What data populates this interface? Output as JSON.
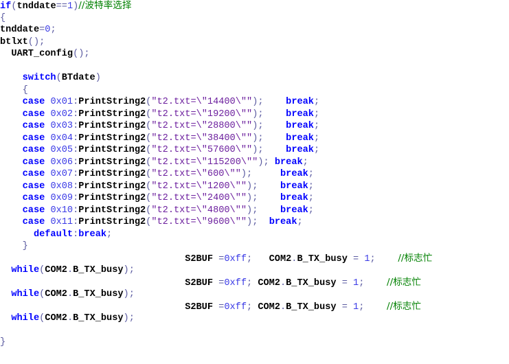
{
  "code_lines": [
    {
      "segments": [
        {
          "t": "if",
          "c": "kw"
        },
        {
          "t": "(",
          "c": "op"
        },
        {
          "t": "tnddate",
          "c": "id"
        },
        {
          "t": "==",
          "c": "op"
        },
        {
          "t": "1",
          "c": "num"
        },
        {
          "t": ")",
          "c": "op"
        },
        {
          "t": "//波特率选择",
          "c": "cmt"
        }
      ]
    },
    {
      "segments": [
        {
          "t": "{",
          "c": "op"
        }
      ]
    },
    {
      "segments": [
        {
          "t": "tnddate",
          "c": "id"
        },
        {
          "t": "=",
          "c": "op"
        },
        {
          "t": "0",
          "c": "num"
        },
        {
          "t": ";",
          "c": "op"
        }
      ]
    },
    {
      "segments": [
        {
          "t": "btlxt",
          "c": "id"
        },
        {
          "t": "();",
          "c": "op"
        }
      ]
    },
    {
      "segments": [
        {
          "t": "  "
        },
        {
          "t": "UART_config",
          "c": "id"
        },
        {
          "t": "();",
          "c": "op"
        }
      ]
    },
    {
      "segments": []
    },
    {
      "segments": [
        {
          "t": "    "
        },
        {
          "t": "switch",
          "c": "kw"
        },
        {
          "t": "(",
          "c": "op"
        },
        {
          "t": "BTdate",
          "c": "id"
        },
        {
          "t": ")",
          "c": "op"
        }
      ]
    },
    {
      "segments": [
        {
          "t": "    "
        },
        {
          "t": "{",
          "c": "op"
        }
      ]
    },
    {
      "segments": [
        {
          "t": "    "
        },
        {
          "t": "case",
          "c": "kw"
        },
        {
          "t": " "
        },
        {
          "t": "0x01",
          "c": "num"
        },
        {
          "t": ":",
          "c": "op"
        },
        {
          "t": "PrintString2",
          "c": "id"
        },
        {
          "t": "(",
          "c": "op"
        },
        {
          "t": "\"t2.txt=\\\"14400\\\"\"",
          "c": "str"
        },
        {
          "t": ");",
          "c": "op"
        },
        {
          "t": "    "
        },
        {
          "t": "break",
          "c": "kw"
        },
        {
          "t": ";",
          "c": "op"
        }
      ]
    },
    {
      "segments": [
        {
          "t": "    "
        },
        {
          "t": "case",
          "c": "kw"
        },
        {
          "t": " "
        },
        {
          "t": "0x02",
          "c": "num"
        },
        {
          "t": ":",
          "c": "op"
        },
        {
          "t": "PrintString2",
          "c": "id"
        },
        {
          "t": "(",
          "c": "op"
        },
        {
          "t": "\"t2.txt=\\\"19200\\\"\"",
          "c": "str"
        },
        {
          "t": ");",
          "c": "op"
        },
        {
          "t": "    "
        },
        {
          "t": "break",
          "c": "kw"
        },
        {
          "t": ";",
          "c": "op"
        }
      ]
    },
    {
      "segments": [
        {
          "t": "    "
        },
        {
          "t": "case",
          "c": "kw"
        },
        {
          "t": " "
        },
        {
          "t": "0x03",
          "c": "num"
        },
        {
          "t": ":",
          "c": "op"
        },
        {
          "t": "PrintString2",
          "c": "id"
        },
        {
          "t": "(",
          "c": "op"
        },
        {
          "t": "\"t2.txt=\\\"28800\\\"\"",
          "c": "str"
        },
        {
          "t": ");",
          "c": "op"
        },
        {
          "t": "    "
        },
        {
          "t": "break",
          "c": "kw"
        },
        {
          "t": ";",
          "c": "op"
        }
      ]
    },
    {
      "segments": [
        {
          "t": "    "
        },
        {
          "t": "case",
          "c": "kw"
        },
        {
          "t": " "
        },
        {
          "t": "0x04",
          "c": "num"
        },
        {
          "t": ":",
          "c": "op"
        },
        {
          "t": "PrintString2",
          "c": "id"
        },
        {
          "t": "(",
          "c": "op"
        },
        {
          "t": "\"t2.txt=\\\"38400\\\"\"",
          "c": "str"
        },
        {
          "t": ");",
          "c": "op"
        },
        {
          "t": "    "
        },
        {
          "t": "break",
          "c": "kw"
        },
        {
          "t": ";",
          "c": "op"
        }
      ]
    },
    {
      "segments": [
        {
          "t": "    "
        },
        {
          "t": "case",
          "c": "kw"
        },
        {
          "t": " "
        },
        {
          "t": "0x05",
          "c": "num"
        },
        {
          "t": ":",
          "c": "op"
        },
        {
          "t": "PrintString2",
          "c": "id"
        },
        {
          "t": "(",
          "c": "op"
        },
        {
          "t": "\"t2.txt=\\\"57600\\\"\"",
          "c": "str"
        },
        {
          "t": ");",
          "c": "op"
        },
        {
          "t": "    "
        },
        {
          "t": "break",
          "c": "kw"
        },
        {
          "t": ";",
          "c": "op"
        }
      ]
    },
    {
      "segments": [
        {
          "t": "    "
        },
        {
          "t": "case",
          "c": "kw"
        },
        {
          "t": " "
        },
        {
          "t": "0x06",
          "c": "num"
        },
        {
          "t": ":",
          "c": "op"
        },
        {
          "t": "PrintString2",
          "c": "id"
        },
        {
          "t": "(",
          "c": "op"
        },
        {
          "t": "\"t2.txt=\\\"115200\\\"\"",
          "c": "str"
        },
        {
          "t": ");",
          "c": "op"
        },
        {
          "t": " "
        },
        {
          "t": "break",
          "c": "kw"
        },
        {
          "t": ";",
          "c": "op"
        }
      ]
    },
    {
      "segments": [
        {
          "t": "    "
        },
        {
          "t": "case",
          "c": "kw"
        },
        {
          "t": " "
        },
        {
          "t": "0x07",
          "c": "num"
        },
        {
          "t": ":",
          "c": "op"
        },
        {
          "t": "PrintString2",
          "c": "id"
        },
        {
          "t": "(",
          "c": "op"
        },
        {
          "t": "\"t2.txt=\\\"600\\\"\"",
          "c": "str"
        },
        {
          "t": ");",
          "c": "op"
        },
        {
          "t": "     "
        },
        {
          "t": "break",
          "c": "kw"
        },
        {
          "t": ";",
          "c": "op"
        }
      ]
    },
    {
      "segments": [
        {
          "t": "    "
        },
        {
          "t": "case",
          "c": "kw"
        },
        {
          "t": " "
        },
        {
          "t": "0x08",
          "c": "num"
        },
        {
          "t": ":",
          "c": "op"
        },
        {
          "t": "PrintString2",
          "c": "id"
        },
        {
          "t": "(",
          "c": "op"
        },
        {
          "t": "\"t2.txt=\\\"1200\\\"\"",
          "c": "str"
        },
        {
          "t": ");",
          "c": "op"
        },
        {
          "t": "    "
        },
        {
          "t": "break",
          "c": "kw"
        },
        {
          "t": ";",
          "c": "op"
        }
      ]
    },
    {
      "segments": [
        {
          "t": "    "
        },
        {
          "t": "case",
          "c": "kw"
        },
        {
          "t": " "
        },
        {
          "t": "0x09",
          "c": "num"
        },
        {
          "t": ":",
          "c": "op"
        },
        {
          "t": "PrintString2",
          "c": "id"
        },
        {
          "t": "(",
          "c": "op"
        },
        {
          "t": "\"t2.txt=\\\"2400\\\"\"",
          "c": "str"
        },
        {
          "t": ");",
          "c": "op"
        },
        {
          "t": "    "
        },
        {
          "t": "break",
          "c": "kw"
        },
        {
          "t": ";",
          "c": "op"
        }
      ]
    },
    {
      "segments": [
        {
          "t": "    "
        },
        {
          "t": "case",
          "c": "kw"
        },
        {
          "t": " "
        },
        {
          "t": "0x10",
          "c": "num"
        },
        {
          "t": ":",
          "c": "op"
        },
        {
          "t": "PrintString2",
          "c": "id"
        },
        {
          "t": "(",
          "c": "op"
        },
        {
          "t": "\"t2.txt=\\\"4800\\\"\"",
          "c": "str"
        },
        {
          "t": ");",
          "c": "op"
        },
        {
          "t": "    "
        },
        {
          "t": "break",
          "c": "kw"
        },
        {
          "t": ";",
          "c": "op"
        }
      ]
    },
    {
      "segments": [
        {
          "t": "    "
        },
        {
          "t": "case",
          "c": "kw"
        },
        {
          "t": " "
        },
        {
          "t": "0x11",
          "c": "num"
        },
        {
          "t": ":",
          "c": "op"
        },
        {
          "t": "PrintString2",
          "c": "id"
        },
        {
          "t": "(",
          "c": "op"
        },
        {
          "t": "\"t2.txt=\\\"9600\\\"\"",
          "c": "str"
        },
        {
          "t": ");",
          "c": "op"
        },
        {
          "t": "  "
        },
        {
          "t": "break",
          "c": "kw"
        },
        {
          "t": ";",
          "c": "op"
        }
      ]
    },
    {
      "segments": [
        {
          "t": "      "
        },
        {
          "t": "default",
          "c": "kw"
        },
        {
          "t": ":",
          "c": "op"
        },
        {
          "t": "break",
          "c": "kw"
        },
        {
          "t": ";",
          "c": "op"
        }
      ]
    },
    {
      "segments": [
        {
          "t": "    "
        },
        {
          "t": "}",
          "c": "op"
        }
      ]
    },
    {
      "segments": [
        {
          "t": "                                 "
        },
        {
          "t": "S2BUF",
          "c": "id"
        },
        {
          "t": " ",
          "c": "op"
        },
        {
          "t": "=",
          "c": "op"
        },
        {
          "t": "0xff",
          "c": "num"
        },
        {
          "t": ";",
          "c": "op"
        },
        {
          "t": "   "
        },
        {
          "t": "COM2",
          "c": "id"
        },
        {
          "t": ".",
          "c": "op"
        },
        {
          "t": "B_TX_busy",
          "c": "id"
        },
        {
          "t": " = ",
          "c": "op"
        },
        {
          "t": "1",
          "c": "num"
        },
        {
          "t": ";",
          "c": "op"
        },
        {
          "t": "    "
        },
        {
          "t": "//标志忙",
          "c": "cmt"
        }
      ]
    },
    {
      "segments": [
        {
          "t": "  "
        },
        {
          "t": "while",
          "c": "kw"
        },
        {
          "t": "(",
          "c": "op"
        },
        {
          "t": "COM2",
          "c": "id"
        },
        {
          "t": ".",
          "c": "op"
        },
        {
          "t": "B_TX_busy",
          "c": "id"
        },
        {
          "t": ");",
          "c": "op"
        }
      ]
    },
    {
      "segments": [
        {
          "t": "                                 "
        },
        {
          "t": "S2BUF",
          "c": "id"
        },
        {
          "t": " ",
          "c": "op"
        },
        {
          "t": "=",
          "c": "op"
        },
        {
          "t": "0xff",
          "c": "num"
        },
        {
          "t": ";",
          "c": "op"
        },
        {
          "t": " "
        },
        {
          "t": "COM2",
          "c": "id"
        },
        {
          "t": ".",
          "c": "op"
        },
        {
          "t": "B_TX_busy",
          "c": "id"
        },
        {
          "t": " = ",
          "c": "op"
        },
        {
          "t": "1",
          "c": "num"
        },
        {
          "t": ";",
          "c": "op"
        },
        {
          "t": "    "
        },
        {
          "t": "//标志忙",
          "c": "cmt"
        }
      ]
    },
    {
      "segments": [
        {
          "t": "  "
        },
        {
          "t": "while",
          "c": "kw"
        },
        {
          "t": "(",
          "c": "op"
        },
        {
          "t": "COM2",
          "c": "id"
        },
        {
          "t": ".",
          "c": "op"
        },
        {
          "t": "B_TX_busy",
          "c": "id"
        },
        {
          "t": ");",
          "c": "op"
        }
      ]
    },
    {
      "segments": [
        {
          "t": "                                 "
        },
        {
          "t": "S2BUF",
          "c": "id"
        },
        {
          "t": " ",
          "c": "op"
        },
        {
          "t": "=",
          "c": "op"
        },
        {
          "t": "0xff",
          "c": "num"
        },
        {
          "t": ";",
          "c": "op"
        },
        {
          "t": " "
        },
        {
          "t": "COM2",
          "c": "id"
        },
        {
          "t": ".",
          "c": "op"
        },
        {
          "t": "B_TX_busy",
          "c": "id"
        },
        {
          "t": " = ",
          "c": "op"
        },
        {
          "t": "1",
          "c": "num"
        },
        {
          "t": ";",
          "c": "op"
        },
        {
          "t": "    "
        },
        {
          "t": "//标志忙",
          "c": "cmt"
        }
      ]
    },
    {
      "segments": [
        {
          "t": "  "
        },
        {
          "t": "while",
          "c": "kw"
        },
        {
          "t": "(",
          "c": "op"
        },
        {
          "t": "COM2",
          "c": "id"
        },
        {
          "t": ".",
          "c": "op"
        },
        {
          "t": "B_TX_busy",
          "c": "id"
        },
        {
          "t": ");",
          "c": "op"
        }
      ]
    },
    {
      "segments": []
    },
    {
      "segments": [
        {
          "t": "}",
          "c": "op"
        }
      ]
    }
  ],
  "colors": {
    "background": "#ffffff",
    "keyword": "#0000ff",
    "identifier": "#000000",
    "number": "#3a3ae6",
    "string": "#6c1f9e",
    "punctuation": "#5a5aa0",
    "comment": "#008000"
  }
}
